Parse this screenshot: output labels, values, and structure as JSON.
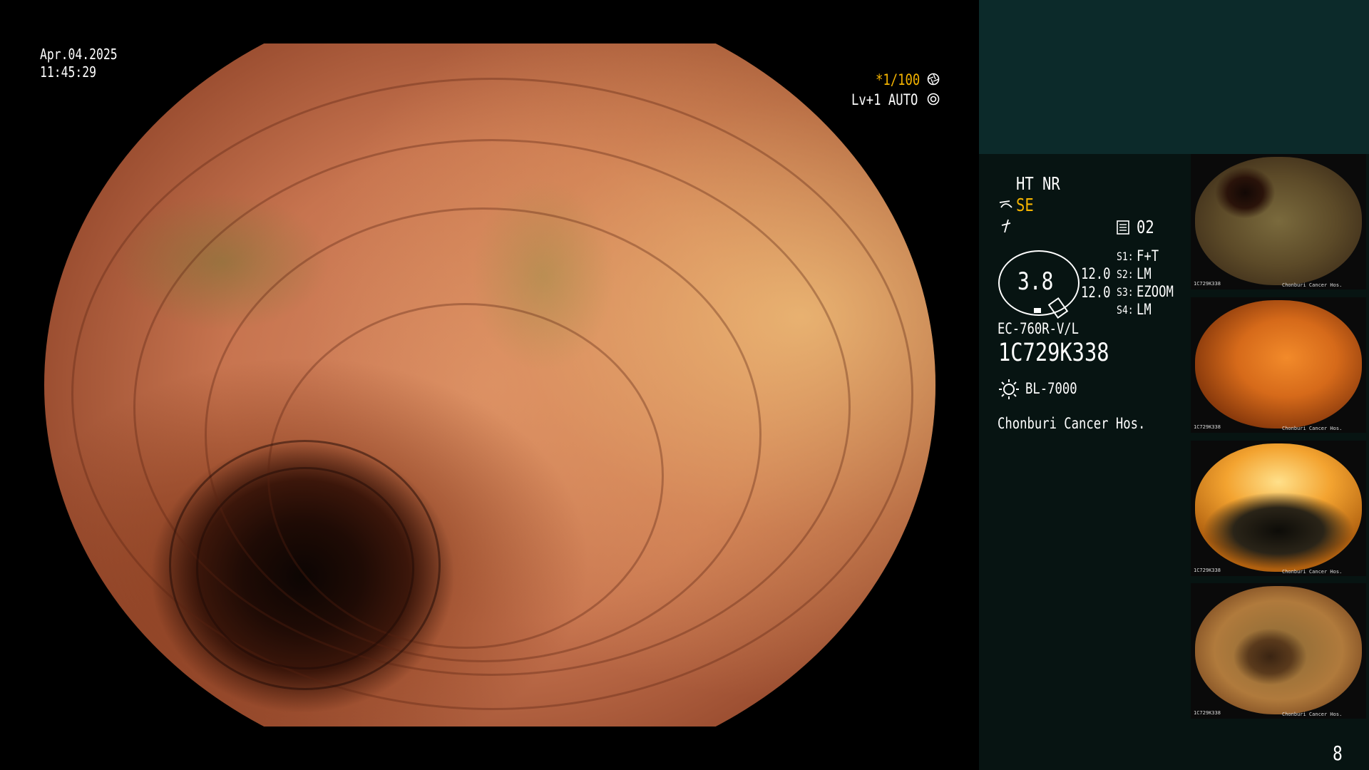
{
  "main_overlay": {
    "date": "Apr.04.2025",
    "time": "11:45:29",
    "shutter": "*1/100",
    "level_mode": "Lv+1 AUTO"
  },
  "status_panel": {
    "enhancement": "HT NR",
    "mode": "SE",
    "record_icon_value": "02",
    "gauge_value": "3.8",
    "value_1": "12.0",
    "value_2": "12.0",
    "switches": [
      {
        "key": "S1:",
        "value": "F+T"
      },
      {
        "key": "S2:",
        "value": "LM"
      },
      {
        "key": "S3:",
        "value": "EZOOM"
      },
      {
        "key": "S4:",
        "value": "LM"
      }
    ],
    "scope_model": "EC-760R-V/L",
    "serial": "1C729K338",
    "light_source": "BL-7000",
    "hospital": "Chonburi Cancer Hos."
  },
  "thumbnails": [
    {
      "name": "thumbnail-1",
      "serial": "1C729K338",
      "hospital": "Chonburi Cancer Hos."
    },
    {
      "name": "thumbnail-2",
      "serial": "1C729K338",
      "hospital": "Chonburi Cancer Hos."
    },
    {
      "name": "thumbnail-3",
      "serial": "1C729K338",
      "hospital": "Chonburi Cancer Hos."
    },
    {
      "name": "thumbnail-4",
      "serial": "1C729K338",
      "hospital": "Chonburi Cancer Hos."
    }
  ],
  "page_number": "8",
  "colors": {
    "accent_yellow": "#f5b400",
    "panel_bg": "#071412",
    "panel_top": "#0c2a2a"
  },
  "icons": [
    "aperture-icon",
    "iris-icon",
    "scope-icon",
    "lightning-icon",
    "record-icon",
    "lamp-icon"
  ]
}
